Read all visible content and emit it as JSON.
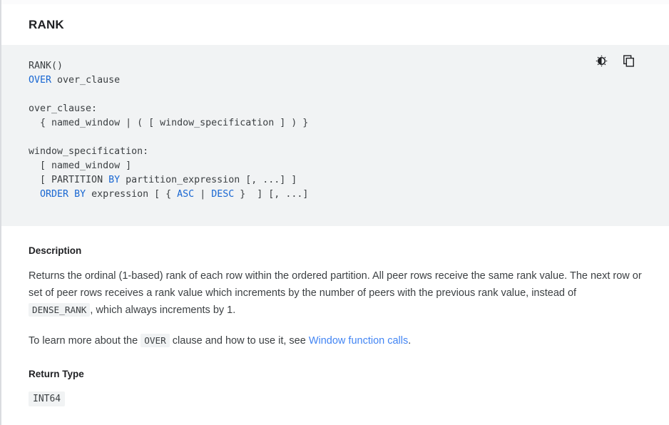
{
  "page": {
    "title": "RANK"
  },
  "code_block": {
    "actions": {
      "theme_toggle_label": "brightness-icon",
      "copy_label": "copy-icon"
    },
    "lines": [
      {
        "segments": [
          {
            "text": "RANK()",
            "kw": false
          }
        ]
      },
      {
        "segments": [
          {
            "text": "OVER",
            "kw": true
          },
          {
            "text": " over_clause",
            "kw": false
          }
        ]
      },
      {
        "segments": [
          {
            "text": "",
            "kw": false
          }
        ]
      },
      {
        "segments": [
          {
            "text": "over_clause:",
            "kw": false
          }
        ]
      },
      {
        "segments": [
          {
            "text": "  { named_window | ( [ window_specification ] ) }",
            "kw": false
          }
        ]
      },
      {
        "segments": [
          {
            "text": "",
            "kw": false
          }
        ]
      },
      {
        "segments": [
          {
            "text": "window_specification:",
            "kw": false
          }
        ]
      },
      {
        "segments": [
          {
            "text": "  [ named_window ]",
            "kw": false
          }
        ]
      },
      {
        "segments": [
          {
            "text": "  [ PARTITION ",
            "kw": false
          },
          {
            "text": "BY",
            "kw": true
          },
          {
            "text": " partition_expression [, ...] ]",
            "kw": false
          }
        ]
      },
      {
        "segments": [
          {
            "text": "  ",
            "kw": false
          },
          {
            "text": "ORDER",
            "kw": true
          },
          {
            "text": " ",
            "kw": false
          },
          {
            "text": "BY",
            "kw": true
          },
          {
            "text": " expression [ { ",
            "kw": false
          },
          {
            "text": "ASC",
            "kw": true
          },
          {
            "text": " | ",
            "kw": false
          },
          {
            "text": "DESC",
            "kw": true
          },
          {
            "text": " }  ] [, ...]",
            "kw": false
          }
        ]
      }
    ],
    "plain_text": "RANK()\nOVER over_clause\n\nover_clause:\n  { named_window | ( [ window_specification ] ) }\n\nwindow_specification:\n  [ named_window ]\n  [ PARTITION BY partition_expression [, ...] ]\n  ORDER BY expression [ { ASC | DESC }  ] [, ...]"
  },
  "description": {
    "heading": "Description",
    "paragraph1": {
      "part1": "Returns the ordinal (1-based) rank of each row within the ordered partition. All peer rows receive the same rank value. The next row or set of peer rows receives a rank value which increments by the number of peers with the previous rank value, instead of ",
      "code": "DENSE_RANK",
      "part2": ", which always increments by 1."
    },
    "paragraph2": {
      "part1": "To learn more about the ",
      "code": "OVER",
      "part2": " clause and how to use it, see ",
      "link_text": "Window function calls",
      "part3": "."
    }
  },
  "return_type": {
    "heading": "Return Type",
    "value": "INT64"
  },
  "colors": {
    "keyword_blue": "#1967d2",
    "link_blue": "#4285f4",
    "code_background": "#f1f3f4",
    "body_text": "#3c4043",
    "heading_text": "#202124",
    "divider": "#dadce0"
  }
}
